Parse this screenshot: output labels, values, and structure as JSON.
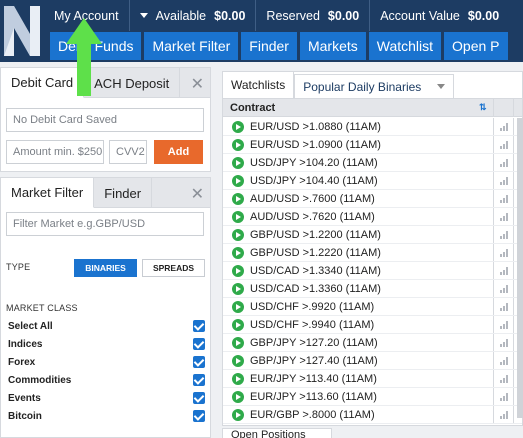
{
  "header": {
    "account_menu": "My Account",
    "available_label": "Available",
    "available_value": "$0.00",
    "reserved_label": "Reserved",
    "reserved_value": "$0.00",
    "account_value_label": "Account Value",
    "account_value": "$0.00",
    "nav": [
      "Debit Funds",
      "Market Filter",
      "Finder",
      "Markets",
      "Watchlist",
      "Open P"
    ]
  },
  "funding": {
    "tabs": [
      "Debit Card",
      "ACH Deposit"
    ],
    "card_field": "No Debit Card Saved",
    "amount_placeholder": "Amount min. $250",
    "cvv_placeholder": "CVV2",
    "add_label": "Add"
  },
  "filter": {
    "tabs": [
      "Market Filter",
      "Finder"
    ],
    "search_placeholder": "Filter Market e.g.GBP/USD",
    "type_label": "TYPE",
    "type_options": [
      "BINARIES",
      "SPREADS"
    ],
    "class_label": "MARKET CLASS",
    "classes": [
      "Select All",
      "Indices",
      "Forex",
      "Commodities",
      "Events",
      "Bitcoin"
    ]
  },
  "watchlist": {
    "tabs": [
      "Watchlists",
      "Popular Daily Binaries"
    ],
    "column": "Contract",
    "rows": [
      "EUR/USD >1.0880 (11AM)",
      "EUR/USD >1.0900 (11AM)",
      "USD/JPY >104.20 (11AM)",
      "USD/JPY >104.40 (11AM)",
      "AUD/USD >.7600 (11AM)",
      "AUD/USD >.7620 (11AM)",
      "GBP/USD >1.2200 (11AM)",
      "GBP/USD >1.2220 (11AM)",
      "USD/CAD >1.3340 (11AM)",
      "USD/CAD >1.3360 (11AM)",
      "USD/CHF >.9920 (11AM)",
      "USD/CHF >.9940 (11AM)",
      "GBP/JPY >127.20 (11AM)",
      "GBP/JPY >127.40 (11AM)",
      "EUR/JPY >113.40 (11AM)",
      "EUR/JPY >113.60 (11AM)",
      "EUR/GBP >.8000 (11AM)"
    ],
    "bottom_tab": "Open Positions"
  },
  "colors": {
    "header_bg": "#1d3c63",
    "nav_button": "#1a73cf",
    "add_button": "#e8692c",
    "play_green": "#2faa4a",
    "arrow_green": "#5ee04a"
  }
}
